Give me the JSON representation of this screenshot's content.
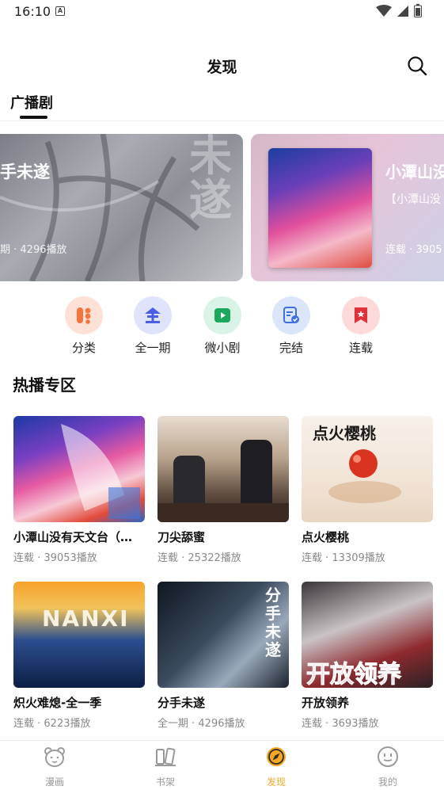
{
  "status": {
    "time": "16:10"
  },
  "header": {
    "title": "发现"
  },
  "tabs": [
    {
      "label": "广播剧"
    }
  ],
  "banners": [
    {
      "title": "手未遂",
      "meta": "期 · 4296播放",
      "deco": "未\n遂"
    },
    {
      "title": "小潭山没",
      "subtitle": "【小潭山没",
      "meta": "连载 · 3905"
    }
  ],
  "categories": [
    {
      "label": "分类",
      "icon": "grid-icon"
    },
    {
      "label": "全一期",
      "icon": "quan-icon"
    },
    {
      "label": "微小剧",
      "icon": "play-icon"
    },
    {
      "label": "完结",
      "icon": "check-document-icon"
    },
    {
      "label": "连载",
      "icon": "bookmark-icon"
    }
  ],
  "section": {
    "title": "热播专区"
  },
  "cards": [
    {
      "title": "小潭山没有天文台（…",
      "meta": "连载 · 39053播放"
    },
    {
      "title": "刀尖舔蜜",
      "meta": "连载 · 25322播放"
    },
    {
      "title": "点火樱桃",
      "meta": "连载 · 13309播放"
    },
    {
      "title": "炽火难熄-全一季",
      "meta": "连载 · 6223播放"
    },
    {
      "title": "分手未遂",
      "meta": "全一期 · 4296播放"
    },
    {
      "title": "开放领养",
      "meta": "连载 · 3693播放"
    }
  ],
  "cover_text": {
    "c3": "点火樱桃",
    "c4": "NANXI",
    "c5": "分手未遂",
    "c6": "开放领养"
  },
  "bottom_nav": [
    {
      "label": "漫画",
      "icon": "bear-icon"
    },
    {
      "label": "书架",
      "icon": "bookshelf-icon"
    },
    {
      "label": "发现",
      "icon": "compass-icon",
      "active": true
    },
    {
      "label": "我的",
      "icon": "profile-face-icon"
    }
  ],
  "colors": {
    "accent": "#f5a623",
    "text": "#111111",
    "muted": "#888888"
  }
}
